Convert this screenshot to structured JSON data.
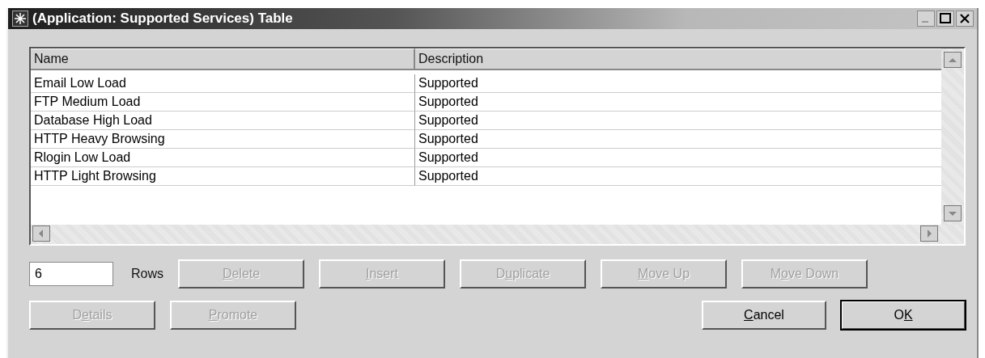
{
  "window": {
    "title": "(Application: Supported Services) Table"
  },
  "table": {
    "columns": [
      "Name",
      "Description"
    ],
    "rows": [
      [
        "Email Low Load",
        "Supported"
      ],
      [
        "FTP Medium Load",
        "Supported"
      ],
      [
        "Database High Load",
        "Supported"
      ],
      [
        "HTTP Heavy Browsing",
        "Supported"
      ],
      [
        "Rlogin Low Load",
        "Supported"
      ],
      [
        "HTTP Light Browsing",
        "Supported"
      ]
    ]
  },
  "rows_field": {
    "value": "6",
    "label": "Rows"
  },
  "row_buttons": [
    {
      "key": "D",
      "post": "elete",
      "disabled": true
    },
    {
      "key": "I",
      "post": "nsert",
      "disabled": true
    },
    {
      "pre": "D",
      "key": "u",
      "post": "plicate",
      "disabled": true
    },
    {
      "key": "M",
      "post": "ove Up",
      "disabled": true
    },
    {
      "pre": "M",
      "key": "o",
      "post": "ve Down",
      "disabled": true
    }
  ],
  "left_buttons": [
    {
      "pre": "D",
      "key": "e",
      "post": "tails",
      "disabled": true
    },
    {
      "key": "P",
      "post": "romote",
      "disabled": true
    }
  ],
  "right_buttons": [
    {
      "key": "C",
      "post": "ancel",
      "disabled": false,
      "default": false
    },
    {
      "pre": "O",
      "key": "K",
      "disabled": false,
      "default": true
    }
  ]
}
